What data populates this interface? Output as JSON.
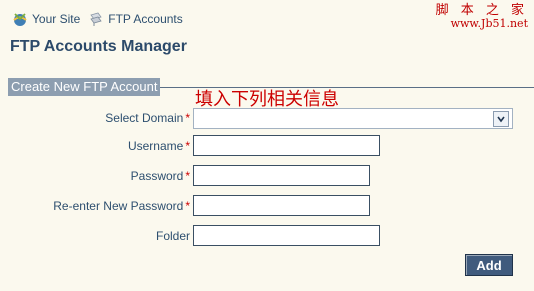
{
  "breadcrumb": {
    "items": [
      {
        "label": "Your Site",
        "icon": "globe-icon"
      },
      {
        "label": "FTP Accounts",
        "icon": "ftp-icon"
      }
    ]
  },
  "watermark": {
    "chinese": "脚 本 之 家",
    "url": "www.Jb51.net"
  },
  "page": {
    "title": "FTP Accounts Manager"
  },
  "section": {
    "label": "Create New FTP Account"
  },
  "annotation": {
    "text": "填入下列相关信息"
  },
  "form": {
    "domain": {
      "label": "Select Domain",
      "required": "*",
      "value": ""
    },
    "username": {
      "label": "Username",
      "required": "*",
      "value": ""
    },
    "password": {
      "label": "Password",
      "required": "*",
      "value": ""
    },
    "repassword": {
      "label": "Re-enter New Password",
      "required": "*",
      "value": ""
    },
    "folder": {
      "label": "Folder",
      "value": ""
    },
    "submit": {
      "label": "Add"
    }
  },
  "colors": {
    "background": "#fbf9ee",
    "accent": "#405b7d",
    "required": "#cc0000",
    "annotation": "#cc0000"
  }
}
